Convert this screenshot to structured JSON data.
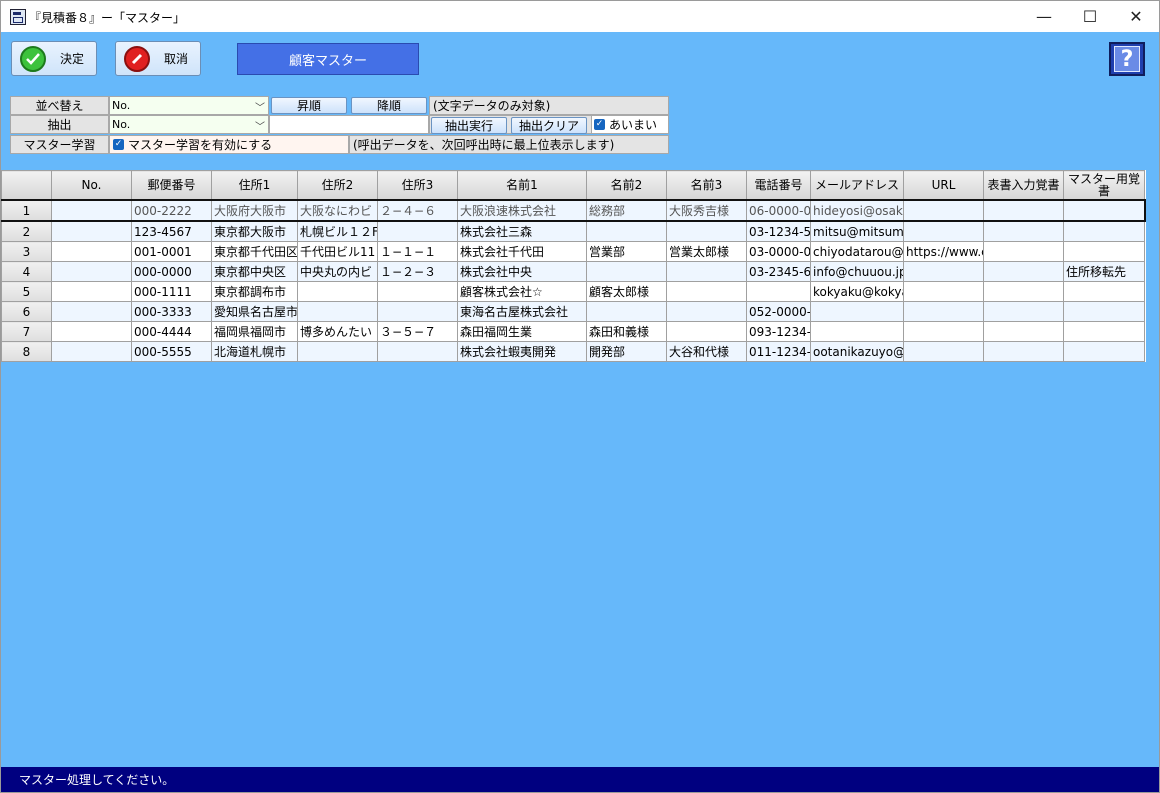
{
  "window": {
    "title": "『見積番８』ー「マスター」",
    "minimize": "—",
    "maximize": "☐",
    "close": "✕"
  },
  "toolbar": {
    "confirm_label": "決定",
    "cancel_label": "取消",
    "screen_title": "顧客マスター",
    "help_label": "?"
  },
  "controls": {
    "sort_label": "並べ替え",
    "sort_value": "No.",
    "asc_label": "昇順",
    "desc_label": "降順",
    "sort_note": "(文字データのみ対象)",
    "filter_label": "抽出",
    "filter_value": "No.",
    "filter_text": "",
    "filter_run_label": "抽出実行",
    "filter_clear_label": "抽出クリア",
    "fuzzy_label": "あいまい",
    "learn_label": "マスター学習",
    "learn_check_label": "マスター学習を有効にする",
    "learn_note": "(呼出データを、次回呼出時に最上位表示します)"
  },
  "grid": {
    "columns": [
      "No.",
      "郵便番号",
      "住所1",
      "住所2",
      "住所3",
      "名前1",
      "名前2",
      "名前3",
      "電話番号",
      "メールアドレス",
      "URL",
      "表書入力覚書",
      "マスター用覚書"
    ],
    "rows": [
      {
        "num": "1",
        "cells": [
          "",
          "000-2222",
          "大阪府大阪市",
          "大阪なにわビ",
          "２−４−６",
          "大阪浪速株式会社",
          "総務部",
          "大阪秀吉様",
          "06-0000-0",
          "hideyosi@osaka.j",
          "",
          "",
          ""
        ]
      },
      {
        "num": "2",
        "cells": [
          "",
          "123-4567",
          "東京都大阪市",
          "札幌ビル１２F",
          "",
          "株式会社三森",
          "",
          "",
          "03-1234-5",
          "mitsu@mitsumor",
          "",
          "",
          ""
        ]
      },
      {
        "num": "3",
        "cells": [
          "",
          "001-0001",
          "東京都千代田区",
          "千代田ビル11",
          "１−１−１",
          "株式会社千代田",
          "営業部",
          "営業太郎様",
          "03-0000-0",
          "chiyodatarou@ch",
          "https://www.c",
          "",
          ""
        ]
      },
      {
        "num": "4",
        "cells": [
          "",
          "000-0000",
          "東京都中央区",
          "中央丸の内ビ",
          "１−２−３",
          "株式会社中央",
          "",
          "",
          "03-2345-6",
          "info@chuuou.jp",
          "",
          "",
          "住所移転先"
        ]
      },
      {
        "num": "5",
        "cells": [
          "",
          "000-1111",
          "東京都調布市",
          "",
          "",
          "顧客株式会社☆",
          "顧客太郎様",
          "",
          "",
          "kokyaku@kokyak",
          "",
          "",
          ""
        ]
      },
      {
        "num": "6",
        "cells": [
          "",
          "000-3333",
          "愛知県名古屋市",
          "",
          "",
          "東海名古屋株式会社",
          "",
          "",
          "052-0000-",
          "",
          "",
          "",
          ""
        ]
      },
      {
        "num": "7",
        "cells": [
          "",
          "000-4444",
          "福岡県福岡市",
          "博多めんたい",
          "３−５−７",
          "森田福岡生業",
          "森田和義様",
          "",
          "093-1234-",
          "",
          "",
          "",
          ""
        ]
      },
      {
        "num": "8",
        "cells": [
          "",
          "000-5555",
          "北海道札幌市",
          "",
          "",
          "株式会社蝦夷開発",
          "開発部",
          "大谷和代様",
          "011-1234-",
          "ootanikazuyo@e",
          "",
          "",
          ""
        ]
      }
    ]
  },
  "status": {
    "message": "マスター処理してください。"
  }
}
